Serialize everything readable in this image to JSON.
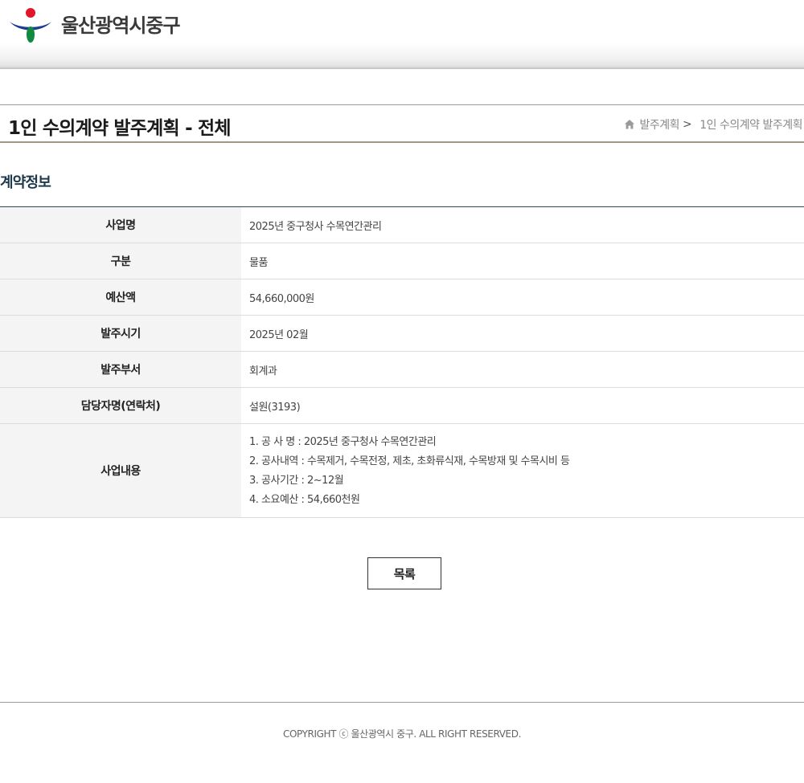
{
  "header": {
    "logo_text": "울산광역시중구",
    "logo_colors": {
      "red": "#e2162b",
      "blue": "#1a3d93",
      "green": "#0f8a3e"
    }
  },
  "title_bar": {
    "title": "1인 수의계약 발주계획 - 전체",
    "breadcrumb": {
      "home_icon": "home-icon",
      "items": [
        "발주계획",
        "1인 수의계약 발주계획"
      ],
      "separator": ">"
    }
  },
  "section": {
    "title": "계약정보"
  },
  "table": {
    "rows": [
      {
        "label": "사업명",
        "value": "2025년 중구청사 수목연간관리"
      },
      {
        "label": "구분",
        "value": "물품"
      },
      {
        "label": "예산액",
        "value": "54,660,000원"
      },
      {
        "label": "발주시기",
        "value": "2025년 02월"
      },
      {
        "label": "발주부서",
        "value": "회계과"
      },
      {
        "label": "담당자명(연락처)",
        "value": "설원(3193)"
      }
    ],
    "content_row": {
      "label": "사업내용",
      "lines": [
        "1. 공 사 명 : 2025년 중구청사 수목연간관리",
        "2. 공사내역 : 수목제거, 수목전정, 제초, 초화류식재, 수목방재 및 수목시비 등",
        "3. 공사기간 : 2~12월",
        "4. 소요예산 : 54,660천원"
      ]
    }
  },
  "buttons": {
    "list_label": "목록"
  },
  "footer": {
    "copyright": "COPYRIGHT ⓒ 울산광역시 중구. ALL RIGHT RESERVED."
  }
}
